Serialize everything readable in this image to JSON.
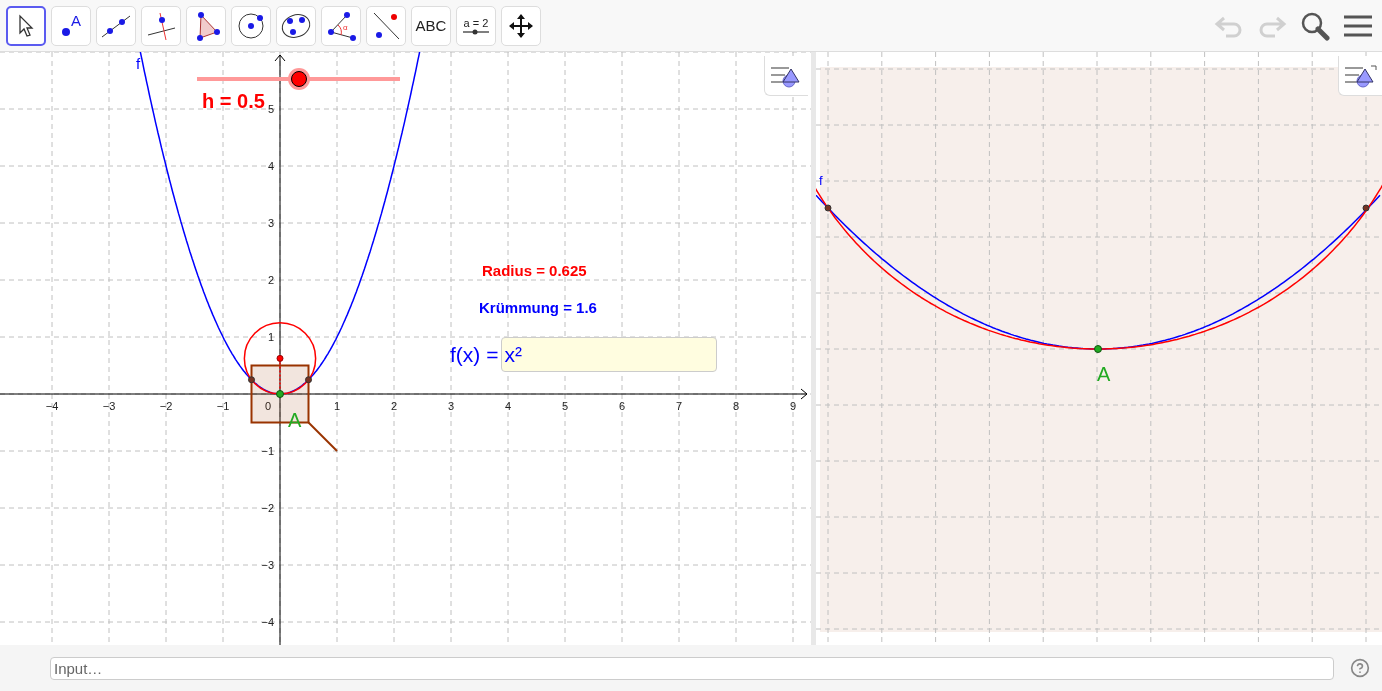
{
  "toolbar": {
    "tools": [
      {
        "kind": "move",
        "selected": true
      },
      {
        "kind": "point",
        "label": "A",
        "selected": false
      },
      {
        "kind": "line",
        "selected": false
      },
      {
        "kind": "perpendicular",
        "selected": false
      },
      {
        "kind": "polygon",
        "selected": false
      },
      {
        "kind": "circle",
        "selected": false
      },
      {
        "kind": "conic",
        "selected": false
      },
      {
        "kind": "angle",
        "label": "α",
        "selected": false
      },
      {
        "kind": "reflect",
        "selected": false
      },
      {
        "kind": "text",
        "label": "ABC",
        "selected": false
      },
      {
        "kind": "slider",
        "label": "a = 2",
        "selected": false
      },
      {
        "kind": "pan",
        "selected": false
      }
    ],
    "undo": {
      "disabled": true
    },
    "redo": {
      "disabled": true
    }
  },
  "graphics": {
    "x_tick_labels": [
      "−4",
      "−3",
      "−2",
      "−1",
      "0",
      "1",
      "2",
      "3",
      "4",
      "5",
      "6",
      "7",
      "8",
      "9"
    ],
    "y_tick_labels": [
      "5",
      "4",
      "3",
      "2",
      "1",
      "−1",
      "−2",
      "−3",
      "−4"
    ],
    "function_label": "f",
    "point_label": "A",
    "slider": {
      "label": "h = 0.5",
      "level": 0.5
    },
    "radius_text": "Radius = 0.625",
    "curvature_text": "Krümmung = 1.6",
    "input_box": {
      "label": "f(x) =",
      "value": "x²"
    }
  },
  "graphics2": {
    "function_label": "f",
    "point_label": "A"
  },
  "input_bar": {
    "placeholder": "Input…"
  }
}
